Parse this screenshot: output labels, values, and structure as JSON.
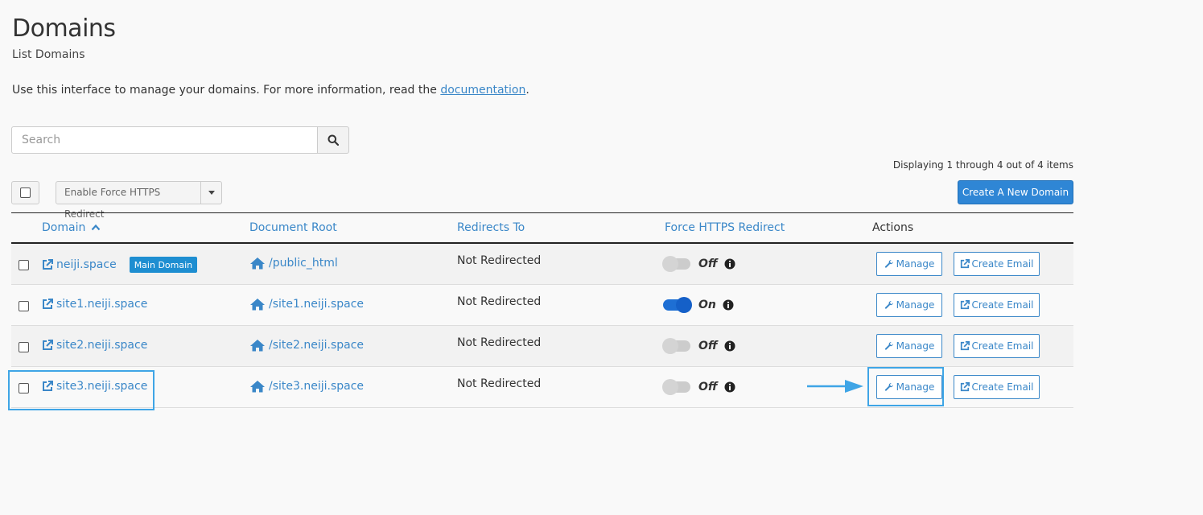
{
  "header": {
    "title": "Domains",
    "subtitle": "List Domains"
  },
  "intro": {
    "text_before": "Use this interface to manage your domains. For more information, read the ",
    "link_text": "documentation",
    "text_after": "."
  },
  "search": {
    "placeholder": "Search",
    "button_icon": "search-icon"
  },
  "pagination": {
    "text": "Displaying 1 through 4 out of 4 items"
  },
  "toolbar": {
    "bulk_action_label": "Enable Force HTTPS Redirect",
    "create_button_label": "Create A New Domain"
  },
  "table": {
    "columns": {
      "domain": "Domain",
      "document_root": "Document Root",
      "redirects_to": "Redirects To",
      "force_https": "Force HTTPS Redirect",
      "actions": "Actions"
    },
    "rows": [
      {
        "domain": "neiji.space",
        "badge": "Main Domain",
        "document_root": "/public_html",
        "redirects_to": "Not Redirected",
        "force_https": "Off",
        "manage_label": "Manage",
        "email_label": "Create Email"
      },
      {
        "domain": "site1.neiji.space",
        "badge": "",
        "document_root": "/site1.neiji.space",
        "redirects_to": "Not Redirected",
        "force_https": "On",
        "manage_label": "Manage",
        "email_label": "Create Email"
      },
      {
        "domain": "site2.neiji.space",
        "badge": "",
        "document_root": "/site2.neiji.space",
        "redirects_to": "Not Redirected",
        "force_https": "Off",
        "manage_label": "Manage",
        "email_label": "Create Email"
      },
      {
        "domain": "site3.neiji.space",
        "badge": "",
        "document_root": "/site3.neiji.space",
        "redirects_to": "Not Redirected",
        "force_https": "Off",
        "manage_label": "Manage",
        "email_label": "Create Email"
      }
    ]
  },
  "colors": {
    "link": "#3a87c8",
    "primary_button": "#2f86d5",
    "badge": "#1e8ed1",
    "toggle_on": "#1e6fd4",
    "highlight": "#3fa5e6"
  }
}
